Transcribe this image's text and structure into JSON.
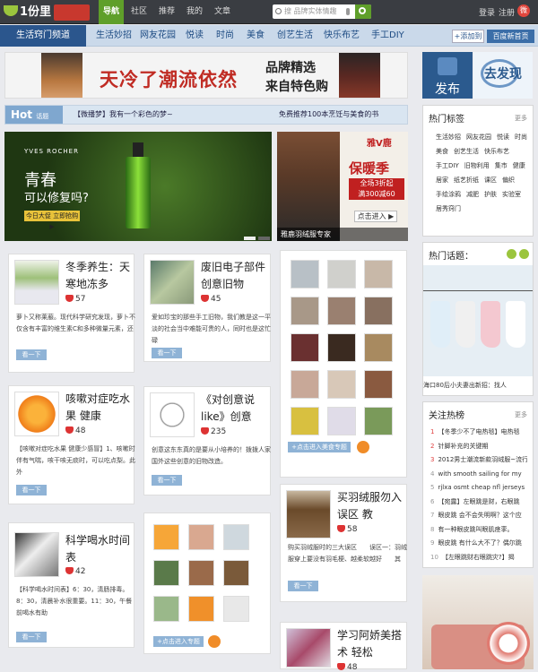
{
  "topbar": {
    "logo": "1份里",
    "nav": [
      {
        "label": "导航",
        "active": true
      },
      {
        "label": "社区",
        "active": false
      },
      {
        "label": "推荐",
        "active": false
      },
      {
        "label": "我的",
        "active": false
      },
      {
        "label": "文章",
        "active": false
      }
    ],
    "search_placeholder": "搜 品牌实体情趣",
    "login": "登录",
    "register": "注册"
  },
  "channel": {
    "title": "生活窍门频道",
    "items": [
      "生活妙招",
      "网友花园",
      "悦读",
      "时尚",
      "美食",
      "创艺生活",
      "快乐布艺",
      "手工DIY"
    ],
    "add": "+添加到",
    "home": "百度新首页"
  },
  "banner": {
    "main": "天冷了潮流依然",
    "line1": "品牌精选",
    "line2": "来自特色购"
  },
  "hot": {
    "label": "Hot",
    "sub": "话题",
    "text1": "【微播梦】我有一个彩色的梦~",
    "text2": "免费推荐100本烹饪与美食的书"
  },
  "slide": {
    "brand": "YVES ROCHER",
    "h1": "青春",
    "h2": "可以修复吗?",
    "cta": "今日大促 立即抢购 ▶"
  },
  "slide2": {
    "logo": "雅V鹿",
    "w1": "保暖季",
    "w2a": "全场3折起",
    "w2b": "满300减60",
    "enter": "点击进入 ▶",
    "caption": "雅鹿羽绒服专家"
  },
  "cards": [
    {
      "title": "冬季养生：天寒地冻多",
      "likes": "57",
      "desc": "萝卜又称莱菔。现代科学研究发现，萝卜不仅含有丰富的维生素C和多种微量元素，还"
    },
    {
      "title": "废旧电子部件创意旧物",
      "likes": "45",
      "desc": "爱如珍宝的那些手工旧物，我们教是这一平淡的社会当中难能可贵的人，同时也是这忙碌"
    },
    {
      "title": "咳嗽对症吃水果 健康",
      "likes": "48",
      "desc": "【咳嗽对症吃水果 健康少感冒】1、咳嗽时伴有气喘，咳干咳无痰时，可以吃点梨。此外"
    },
    {
      "title": "《对创意说like》创意",
      "likes": "235",
      "desc": "创意这东东真的是要从小培养的！拨拨人家国外这些创意的旧物改造。"
    },
    {
      "title": "科学喝水时间表",
      "likes": "42",
      "desc": "【科学喝水时间表】6：30，清肠排毒。8：30，清晨补水很重要。11：30，午餐前喝水有助"
    },
    {
      "title": "买羽绒服勿入误区 教",
      "likes": "58",
      "desc": "购买羽绒服时的三大误区　　误区一：羽绒服穿上要没有羽毛梗、越柔软越好　　其"
    },
    {
      "title": "学习阿娇美搭术 轻松",
      "likes": "48",
      "desc": ""
    }
  ],
  "look_label": "看一下",
  "album_btn": "+点击进入美食专题",
  "album_btn2": "+点击进入专题",
  "right": {
    "publish": "发布",
    "discover": "去发现",
    "tags_title": "热门标签",
    "more": "更多",
    "tags": [
      "生活妙招",
      "网友花园",
      "悦读",
      "时尚",
      "美食",
      "创艺生活",
      "快乐布艺",
      "手工DIY",
      "旧物利用",
      "集市",
      "健康",
      "居家",
      "纸艺折纸",
      "课区",
      "偏织",
      "手绘涂鸦",
      "减肥",
      "护肤",
      "实验室",
      "居秀窍门"
    ],
    "topic_title": "热门话题：",
    "topic_caption": "海口80后小夫妻出新招：找人",
    "rank_title": "关注热榜",
    "rank": [
      "【冬季少不了电热毯】电热毯",
      "针脚补充的关键期",
      "2012男士潮流新款羽绒服~流行",
      "with smooth sailing for my",
      "rjlxa osmt cheap nfl jerseys",
      "【宛露】左眼跳是财，右眼跳",
      "眼皮跳 会不会失明啊？这个应",
      "有一种眼皮跳叫眼肌痉挛。",
      "眼皮跳 有什么大不了？偶尔跳",
      "【左眼跳财右眼跳灾?】揭"
    ]
  }
}
